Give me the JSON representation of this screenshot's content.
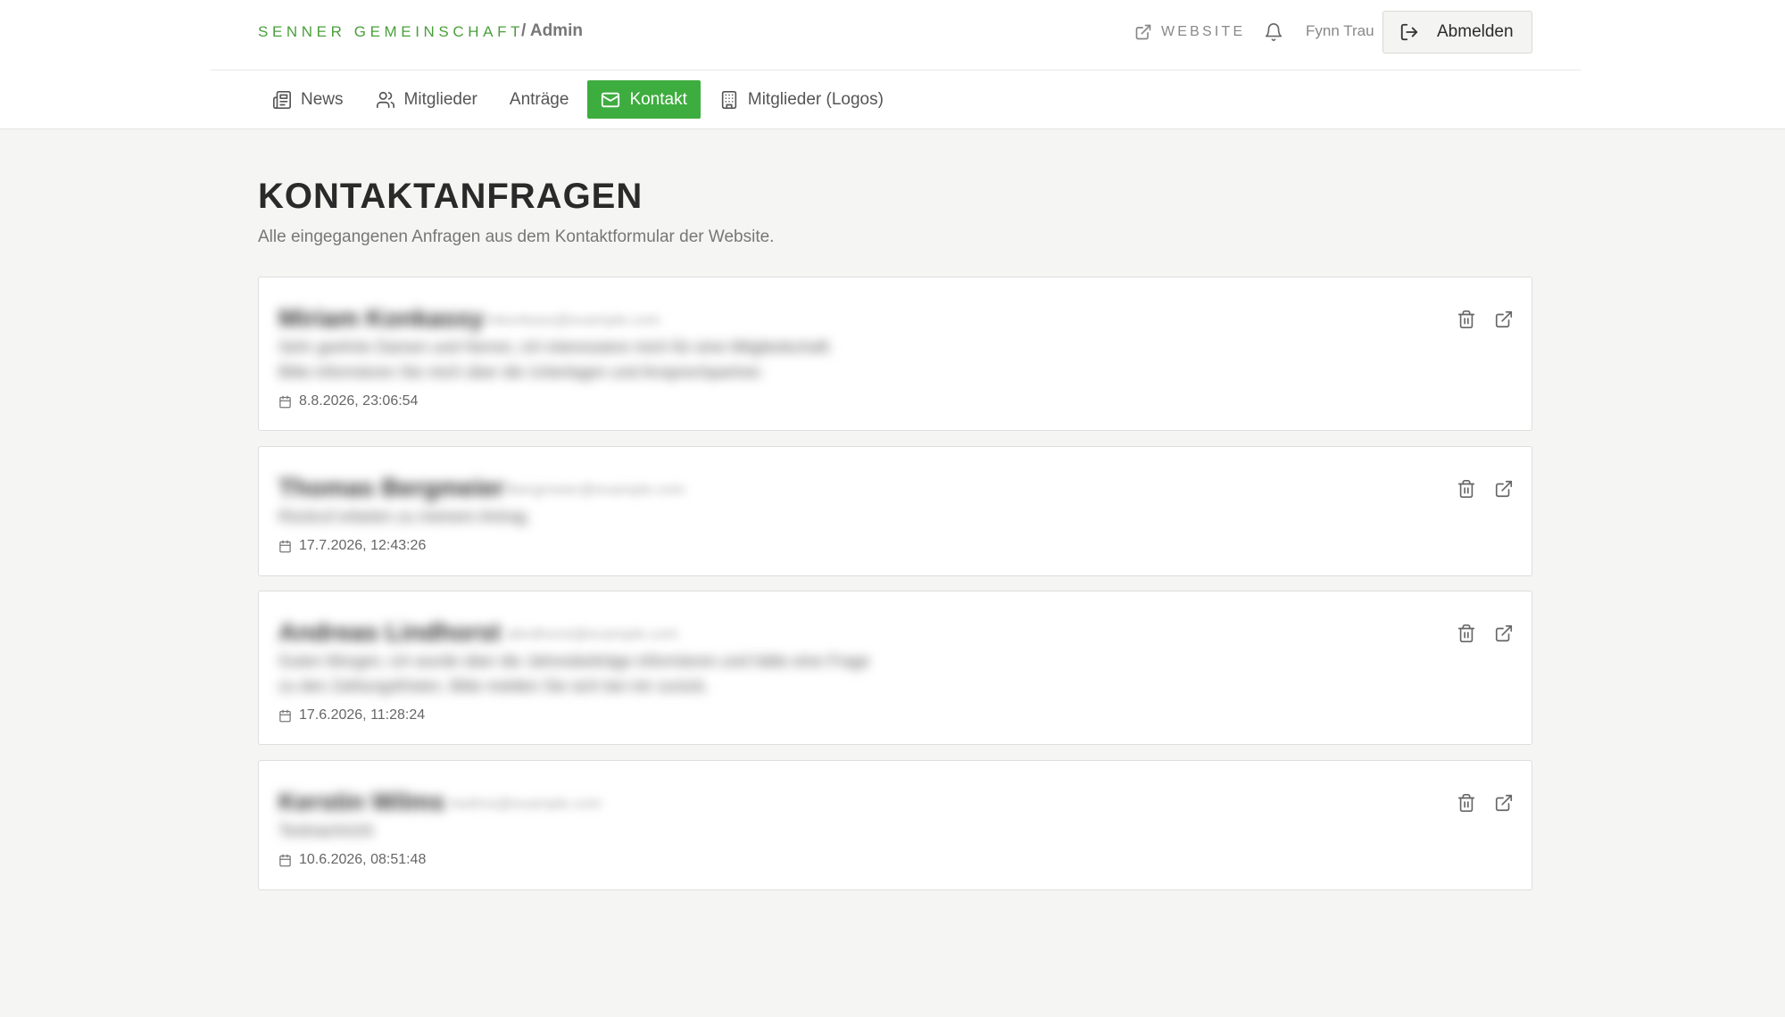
{
  "header": {
    "brand": "SENNER GEMEINSCHAFT",
    "brand_suffix": "/ Admin",
    "website_label": "WEBSITE",
    "username": "Fynn Trau",
    "logout_label": "Abmelden"
  },
  "nav": {
    "items": [
      {
        "label": "News",
        "icon": "newspaper-icon"
      },
      {
        "label": "Mitglieder",
        "icon": "users-icon"
      },
      {
        "label": "Anträge",
        "icon": ""
      },
      {
        "label": "Kontakt",
        "icon": "mail-icon",
        "active": true
      },
      {
        "label": "Mitglieder (Logos)",
        "icon": "building-icon"
      }
    ]
  },
  "page": {
    "title": "KONTAKTANFRAGEN",
    "subtitle": "Alle eingegangenen Anfragen aus dem Kontaktformular der Website."
  },
  "contacts": [
    {
      "date": "8.8.2026, 23:06:54"
    },
    {
      "date": "17.7.2026, 12:43:26"
    },
    {
      "date": "17.6.2026, 11:28:24"
    },
    {
      "date": "10.6.2026, 08:51:48"
    }
  ],
  "colors": {
    "accent": "#3ead3f",
    "brand": "#4a9f3b",
    "background": "#f5f5f3"
  }
}
